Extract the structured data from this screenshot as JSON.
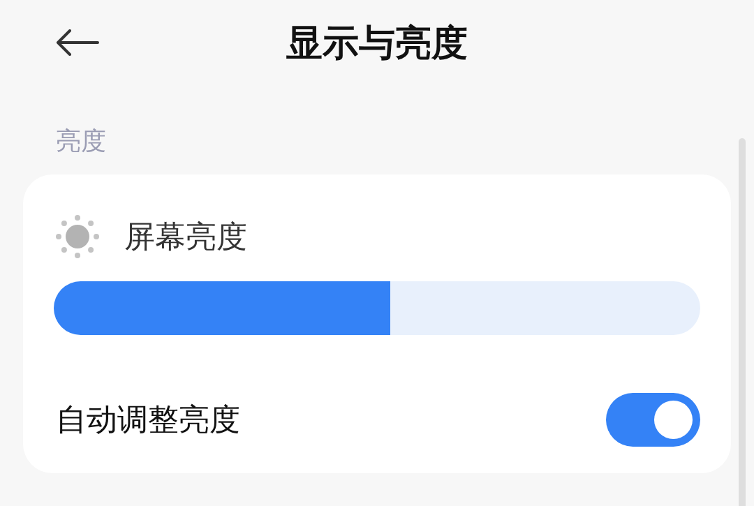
{
  "header": {
    "title": "显示与亮度"
  },
  "section": {
    "label": "亮度"
  },
  "brightness": {
    "label": "屏幕亮度",
    "level": 0.52
  },
  "auto_brightness": {
    "label": "自动调整亮度",
    "on": true
  }
}
